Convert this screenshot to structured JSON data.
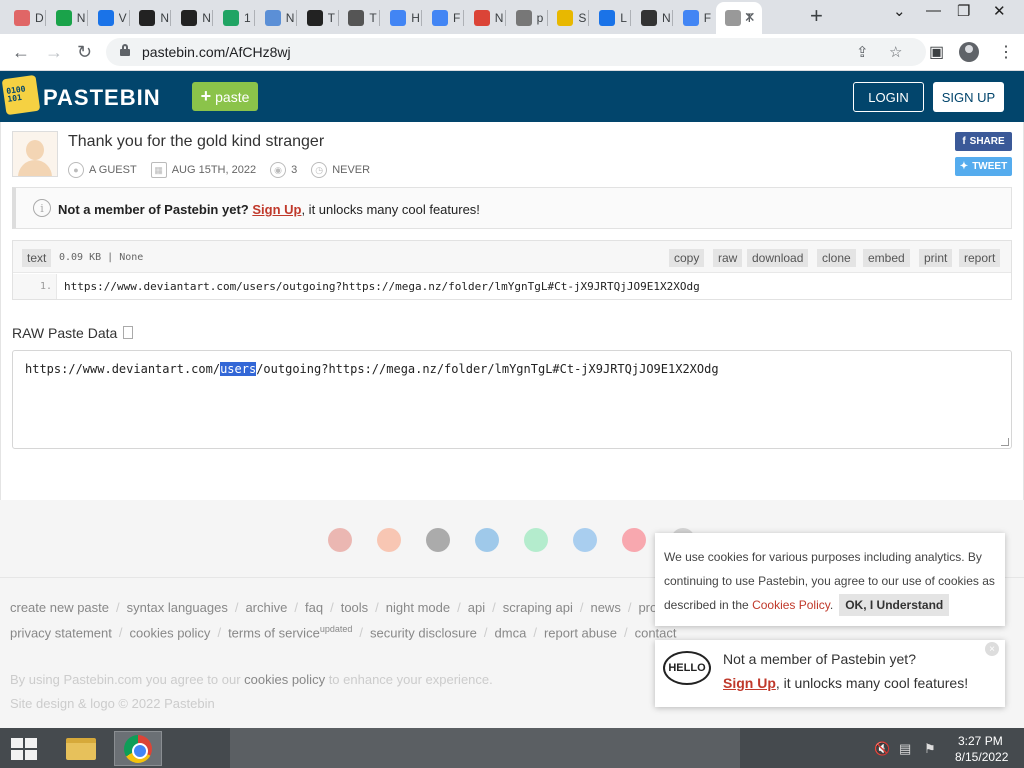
{
  "browser": {
    "tabs": [
      {
        "label": "D",
        "icon": "burst-icon",
        "color": "#e06666"
      },
      {
        "label": "N",
        "icon": "microsoft-icon",
        "color": "#1aa34a"
      },
      {
        "label": "V",
        "icon": "check-icon",
        "color": "#1a73e8"
      },
      {
        "label": "N",
        "icon": "terminal-icon",
        "color": "#222222"
      },
      {
        "label": "N",
        "icon": "terminal-icon",
        "color": "#222222"
      },
      {
        "label": "1",
        "icon": "play-icon",
        "color": "#20a464"
      },
      {
        "label": "N",
        "icon": "news-icon",
        "color": "#5b8fd6"
      },
      {
        "label": "T",
        "icon": "h-icon",
        "color": "#222222"
      },
      {
        "label": "T",
        "icon": "translate-icon",
        "color": "#555555"
      },
      {
        "label": "H",
        "icon": "google-icon",
        "color": "#4285f4"
      },
      {
        "label": "F",
        "icon": "google-icon",
        "color": "#4285f4"
      },
      {
        "label": "N",
        "icon": "chart-icon",
        "color": "#db4437"
      },
      {
        "label": "p",
        "icon": "globe-icon",
        "color": "#777777"
      },
      {
        "label": "S",
        "icon": "circle-icon",
        "color": "#e8b800"
      },
      {
        "label": "L",
        "icon": "check-icon",
        "color": "#1a73e8"
      },
      {
        "label": "N",
        "icon": "github-icon",
        "color": "#333333"
      },
      {
        "label": "F",
        "icon": "google-icon",
        "color": "#4285f4"
      },
      {
        "label": "T",
        "icon": "pastebin-icon",
        "color": "#999999"
      }
    ],
    "url": "pastebin.com/AfCHz8wj"
  },
  "header": {
    "brand": "PASTEBIN",
    "paste_label": "paste",
    "login_label": "LOGIN",
    "signup_label": "SIGN UP"
  },
  "paste": {
    "title": "Thank you for the gold kind stranger",
    "author": "A GUEST",
    "date": "AUG 15TH, 2022",
    "views": "3",
    "expiry": "NEVER",
    "share_label": "SHARE",
    "tweet_label": "TWEET"
  },
  "notice": {
    "lead": "Not a member of Pastebin yet?",
    "link": "Sign Up",
    "rest": ", it unlocks many cool features!"
  },
  "code": {
    "lang": "text",
    "info": "0.09 KB | None",
    "actions": [
      "copy",
      "raw",
      "download",
      "clone",
      "embed",
      "print",
      "report"
    ],
    "line_no": "1.",
    "line": "https://www.deviantart.com/users/outgoing?https://mega.nz/folder/lmYgnTgL#Ct-jX9JRTQjJO9E1X2XOdg"
  },
  "raw": {
    "title": "RAW Paste Data",
    "text_before": "https://www.deviantart.com/",
    "text_selected": "users",
    "text_after": "/outgoing?https://mega.nz/folder/lmYgnTgL#Ct-jX9JRTQjJO9E1X2XOdg"
  },
  "footer": {
    "apps": [
      "chrome",
      "firefox",
      "iOS",
      "windows",
      "android",
      "macos",
      "opera",
      "other"
    ],
    "links1": [
      "create new paste",
      "syntax languages",
      "archive",
      "faq",
      "tools",
      "night mode",
      "api",
      "scraping api",
      "news",
      "pro"
    ],
    "links2": [
      "privacy statement",
      "cookies policy",
      "terms of service",
      "security disclosure",
      "dmca",
      "report abuse",
      "contact"
    ],
    "updated": "updated",
    "note_before": "By using Pastebin.com you agree to our ",
    "note_link": "cookies policy",
    "note_after": " to enhance your experience.",
    "copyright": "Site design & logo © 2022 Pastebin"
  },
  "cookie": {
    "text": "We use cookies for various purposes including analytics. By continuing to use Pastebin, you agree to our use of cookies as described in the ",
    "link": "Cookies Policy",
    "end": ".",
    "button": "OK, I Understand"
  },
  "join": {
    "hello": "HELLO",
    "line1": "Not a member of Pastebin yet?",
    "link": "Sign Up",
    "rest": ", it unlocks many cool features!",
    "close": "×"
  },
  "taskbar": {
    "time": "3:27 PM",
    "date": "8/15/2022"
  }
}
